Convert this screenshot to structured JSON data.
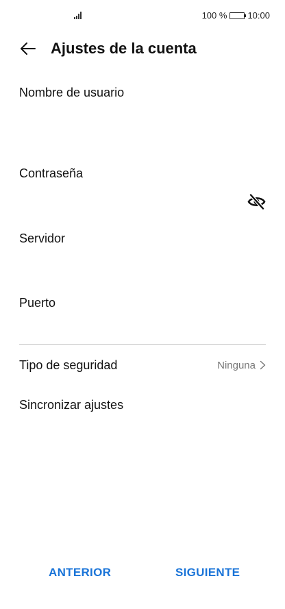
{
  "status_bar": {
    "battery_percent": "100 %",
    "time": "10:00",
    "icons": [
      "signal-icon",
      "battery-icon"
    ]
  },
  "header": {
    "title": "Ajustes de la cuenta",
    "back_icon": "back-arrow-icon"
  },
  "form": {
    "username": {
      "label": "Nombre de usuario",
      "value": ""
    },
    "password": {
      "label": "Contraseña",
      "value": "",
      "toggle_icon": "eye-hidden-icon"
    },
    "server": {
      "label": "Servidor",
      "value": ""
    },
    "port": {
      "label": "Puerto",
      "value": ""
    }
  },
  "settings": {
    "security_type": {
      "label": "Tipo de seguridad",
      "value": "Ninguna"
    },
    "sync_settings": {
      "label": "Sincronizar ajustes"
    }
  },
  "footer": {
    "previous_label": "ANTERIOR",
    "next_label": "SIGUIENTE"
  },
  "colors": {
    "accent": "#1a74d8",
    "text": "#111111",
    "secondary_text": "#777777",
    "divider": "#c8c8c8"
  }
}
